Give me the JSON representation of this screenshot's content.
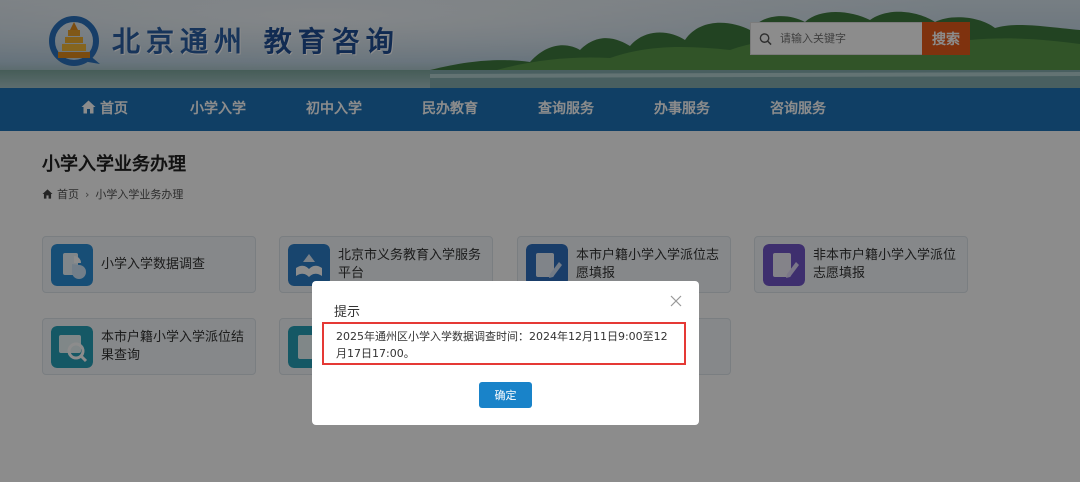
{
  "header": {
    "title_part1": "北京通州",
    "title_part2": "教育咨询",
    "search_placeholder": "请输入关键字",
    "search_button": "搜索"
  },
  "nav": {
    "items": [
      "首页",
      "小学入学",
      "初中入学",
      "民办教育",
      "查询服务",
      "办事服务",
      "咨询服务"
    ]
  },
  "page": {
    "title": "小学入学业务办理",
    "breadcrumb": [
      "首页",
      "小学入学业务办理"
    ]
  },
  "cards": [
    {
      "label": "小学入学数据调查",
      "icon": "document-chart-icon",
      "color": "#2b8fd8"
    },
    {
      "label": "北京市义务教育入学服务平台",
      "icon": "open-book-icon",
      "color": "#2d7ec9"
    },
    {
      "label": "本市户籍小学入学派位志愿填报",
      "icon": "edit-form-icon",
      "color": "#2f6fc0"
    },
    {
      "label": "非本市户籍小学入学派位志愿填报",
      "icon": "edit-form-icon",
      "color": "#7156c8"
    },
    {
      "label": "本市户籍小学入学派位结果查询",
      "icon": "search-result-icon",
      "color": "#27a0b8"
    }
  ],
  "dialog": {
    "title": "提示",
    "message": "2025年通州区小学入学数据调查时间：2024年12月11日9:00至12月17日17:00。",
    "ok_button": "确定"
  },
  "colors": {
    "nav_bg": "#1e74b8",
    "search_button": "#e85b1a",
    "ok_button": "#1983c9",
    "highlight_border": "#e53935"
  }
}
